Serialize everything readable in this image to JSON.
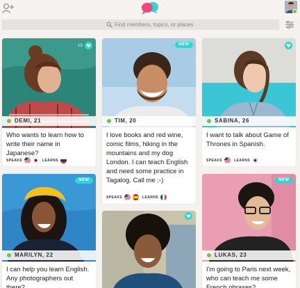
{
  "search": {
    "placeholder": "Find members, topics, or places"
  },
  "labels": {
    "speaks": "SPEAKS",
    "learns": "LEARNS",
    "new": "NEW"
  },
  "colors": {
    "accent": "#2ed8d2",
    "online": "#7ac142",
    "brand_pink": "#f0487a"
  },
  "icons": {
    "add_user": "add-user-icon",
    "logo": "chat-bubbles-logo",
    "search": "search-icon",
    "filter": "filter-icon",
    "favorite": "heart-icon"
  },
  "members": [
    {
      "name": "DEMI, 21",
      "text": "Who wants to learn how to write their name in Japanese?",
      "speaks": [
        "us",
        "jp"
      ],
      "learns": [
        "ru"
      ],
      "count": "13"
    },
    {
      "name": "TIM, 20",
      "text": "I love books and red wine, comic films, hiking in the mountains and my dog London. I can teach English and need some practice in Tagalog. Call me ;-)",
      "speaks": [
        "us",
        "es"
      ],
      "learns": [
        "fr"
      ],
      "badge": "NEW"
    },
    {
      "name": "SABINA, 26",
      "text": "I want to talk about Game of Thrones in Spanish.",
      "speaks": [
        "us"
      ],
      "learns": [
        "jp"
      ]
    },
    {
      "name": "MARILYN, 22",
      "text": "I can help you learn English. Any photographers out there?",
      "badge": "NEW"
    },
    {
      "name": "",
      "text": ""
    },
    {
      "name": "LUKAS, 23",
      "text": "I'm going to Paris next week, who can teach me some French phrases?",
      "badge": "NEW"
    }
  ]
}
